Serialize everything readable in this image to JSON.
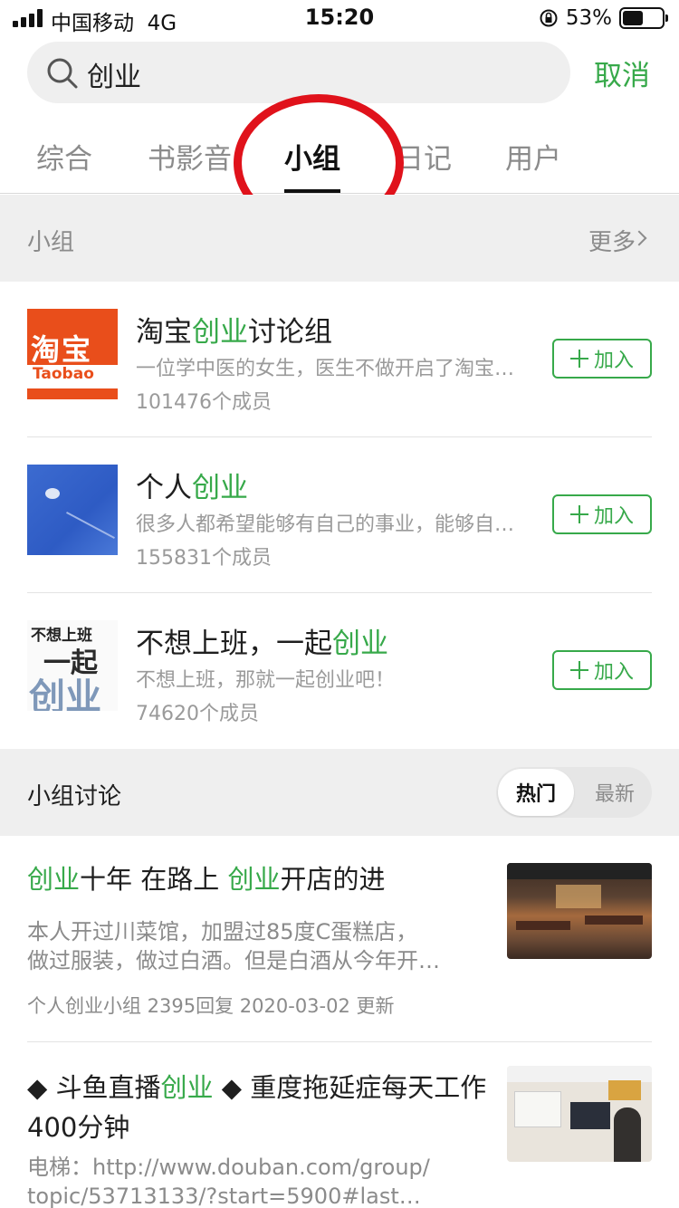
{
  "status_bar": {
    "carrier": "中国移动",
    "network": "4G",
    "time": "15:20",
    "battery_percent": "53%",
    "battery_level": 0.53,
    "icons": [
      "signal-icon",
      "rotation-lock-icon",
      "battery-icon"
    ]
  },
  "search": {
    "query": "创业",
    "cancel_label": "取消"
  },
  "tabs": {
    "items": [
      "综合",
      "书影音",
      "小组",
      "日记",
      "用户"
    ],
    "active": "小组"
  },
  "groups_section": {
    "title": "小组",
    "more_label": "更多",
    "join_label": "加入",
    "items": [
      {
        "name_prefix": "淘宝",
        "name_highlight": "创业",
        "name_suffix": "讨论组",
        "description": "一位学中医的女生，医生不做开启了淘宝创业之路",
        "members": "101476个成员",
        "thumb_text_1": "淘宝",
        "thumb_text_2": "Taobao"
      },
      {
        "name_prefix": "个人",
        "name_highlight": "创业",
        "name_suffix": "",
        "description": "很多人都希望能够有自己的事业，能够自己做老板",
        "members": "155831个成员"
      },
      {
        "name_prefix": "不想上班，一起",
        "name_highlight": "创业",
        "name_suffix": "",
        "description": "不想上班，那就一起创业吧！",
        "members": "74620个成员",
        "thumb_text_1": "不想上班",
        "thumb_text_2": "一起",
        "thumb_text_3": "创业"
      }
    ]
  },
  "discussion_section": {
    "title": "小组讨论",
    "sort_hot": "热门",
    "sort_new": "最新",
    "active_sort": "热门"
  },
  "posts": [
    {
      "title_parts": [
        {
          "text": "创业",
          "hl": true
        },
        {
          "text": "十年 在路上 ",
          "hl": false
        },
        {
          "text": "创业",
          "hl": true
        },
        {
          "text": "开店的进",
          "hl": false
        }
      ],
      "excerpt_line1": "本人开过川菜馆，加盟过85度C蛋糕店，",
      "excerpt_line2": "做过服装，做过白酒。但是白酒从今年开…",
      "meta": "个人创业小组  2395回复  2020-03-02 更新"
    },
    {
      "title_parts": [
        {
          "text": "◆ 斗鱼直播",
          "hl": false
        },
        {
          "text": "创业",
          "hl": true
        },
        {
          "text": " ◆ 重度拖延症每天工作400分钟",
          "hl": false
        }
      ],
      "excerpt_line1": "电梯：http://www.douban.com/group/",
      "excerpt_line2": "topic/53713133/?start=5900#last…"
    }
  ],
  "colors": {
    "accent_green": "#37a94a",
    "annotation_red": "#e0121b",
    "section_bg": "#efefef"
  }
}
